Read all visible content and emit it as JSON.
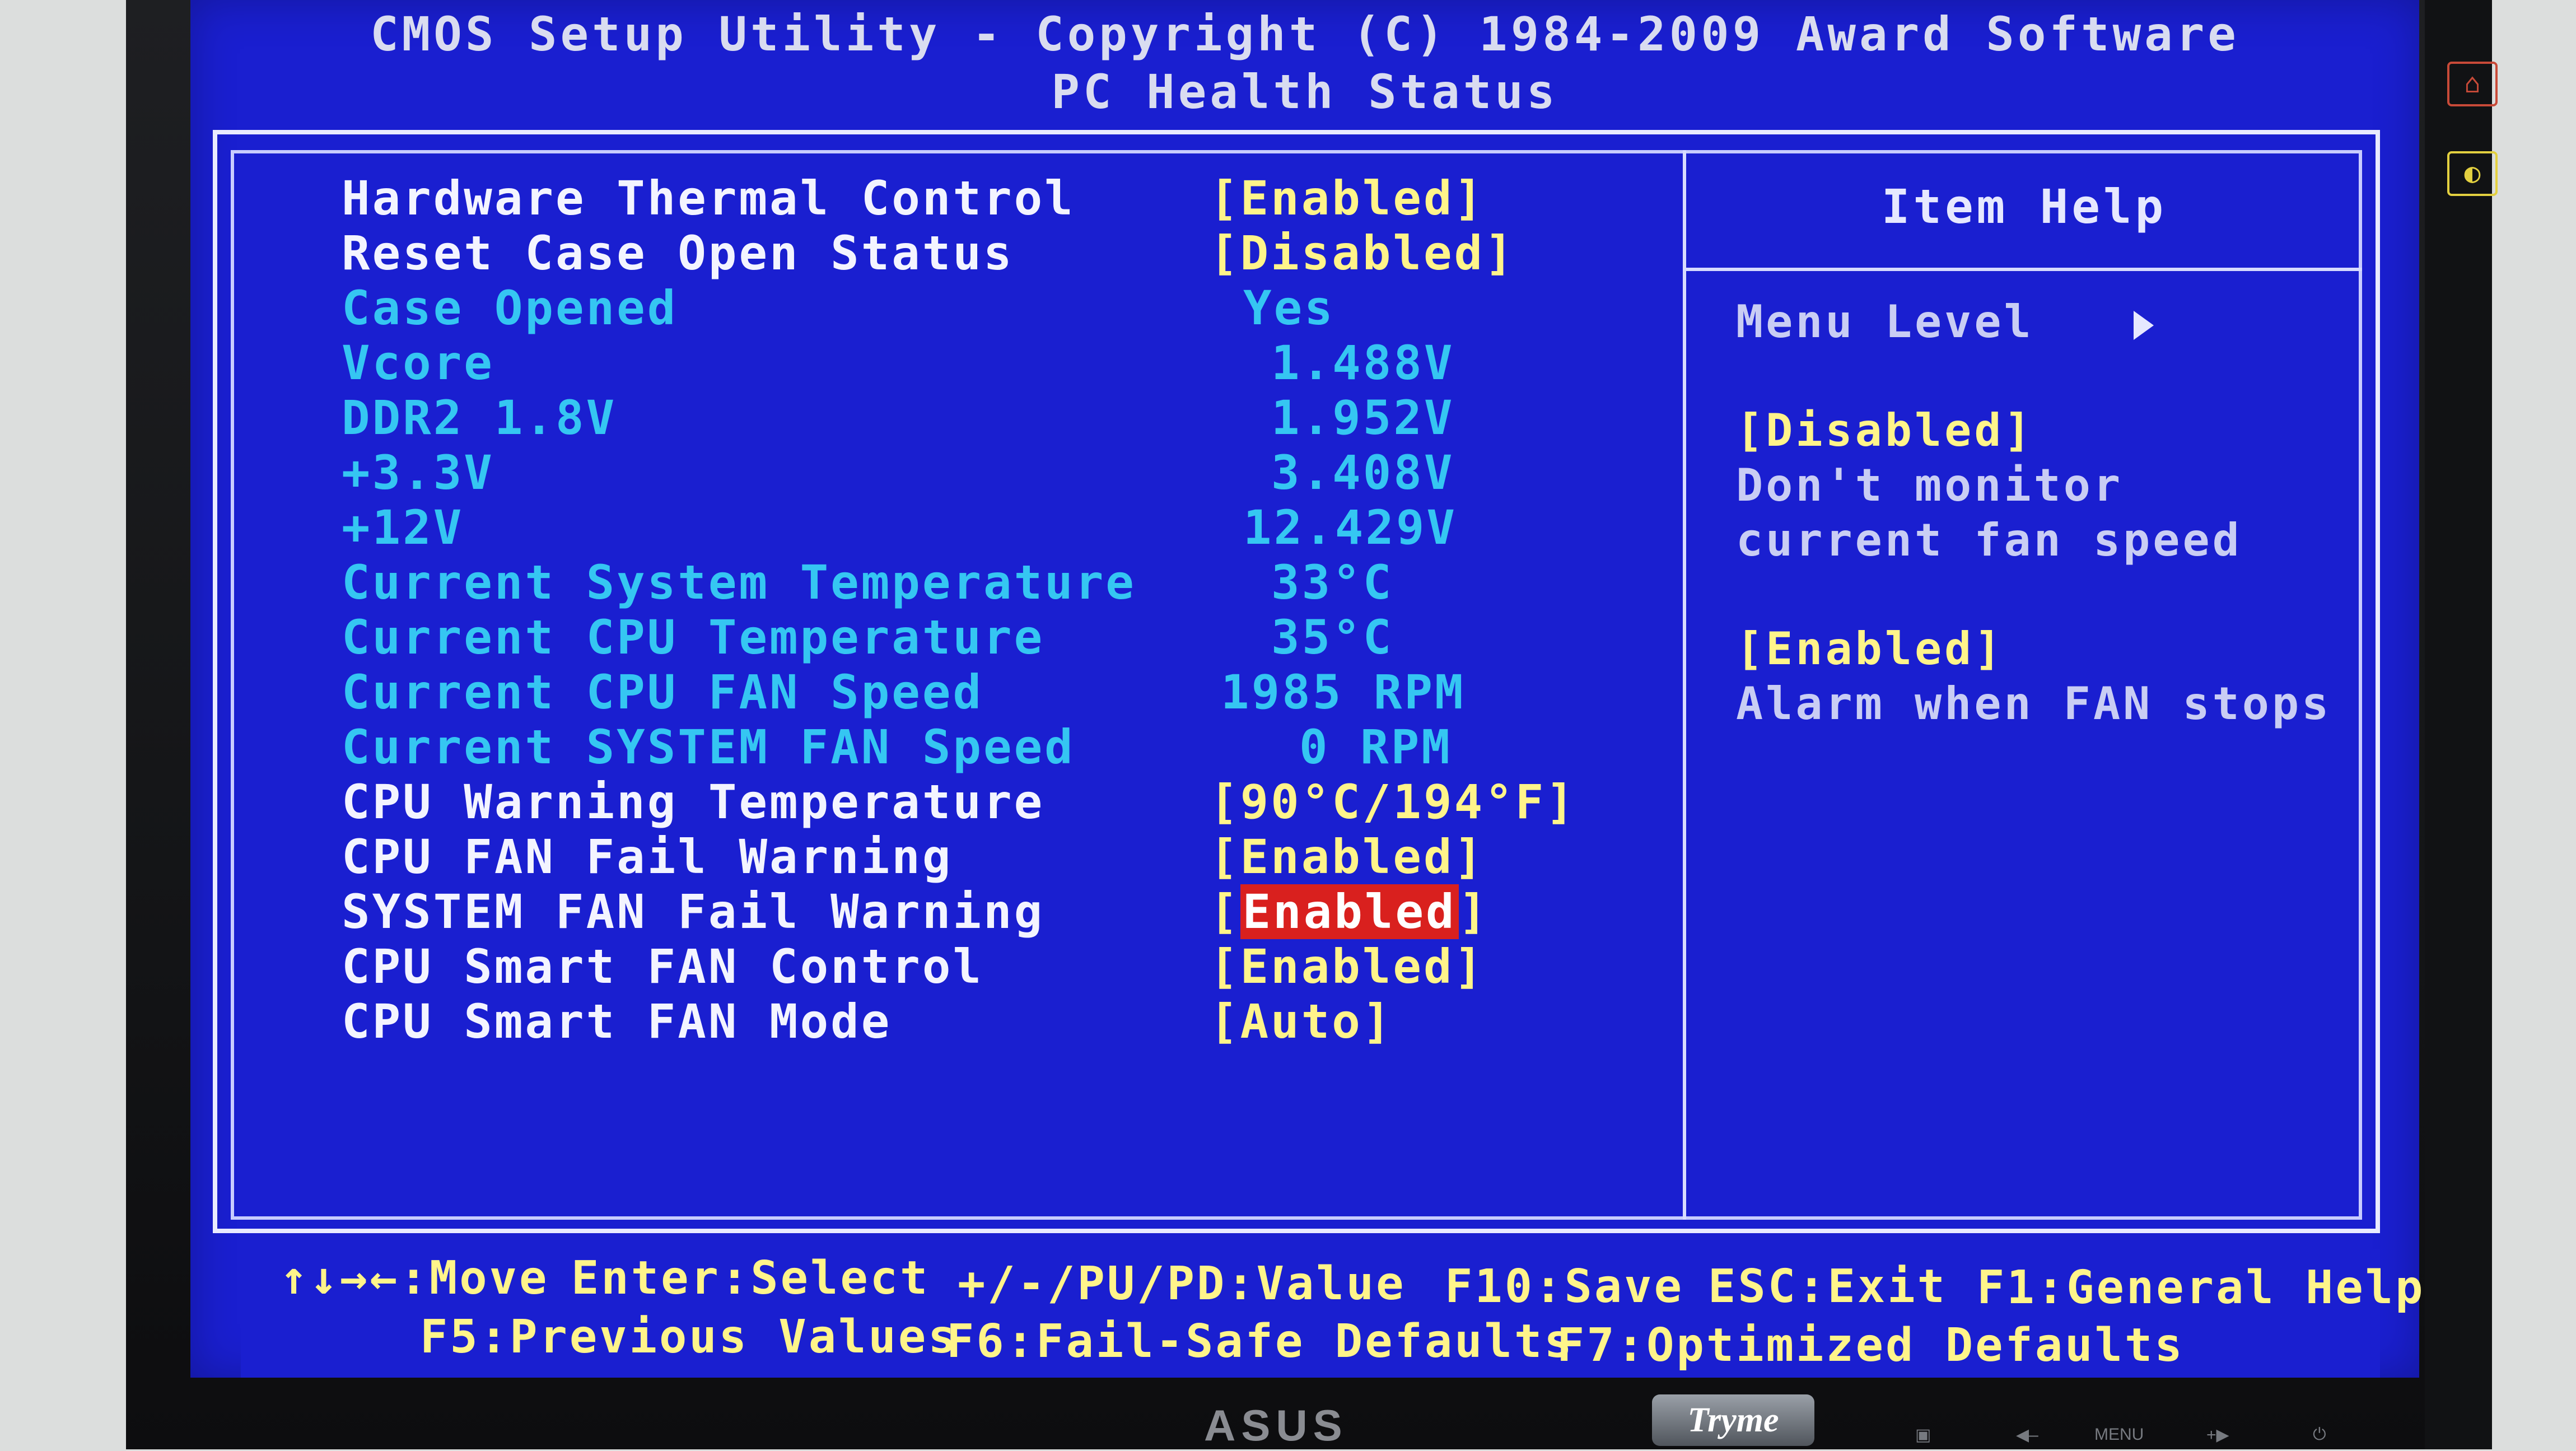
{
  "header": {
    "title": "CMOS Setup Utility - Copyright (C) 1984-2009 Award Software",
    "subtitle": "PC Health Status"
  },
  "settings": [
    {
      "label": "Hardware Thermal Control",
      "value": "[Enabled]",
      "type": "editable"
    },
    {
      "label": "Reset Case Open Status",
      "value": "[Disabled]",
      "type": "editable"
    },
    {
      "label": "Case Opened",
      "value": "Yes",
      "type": "readonly"
    },
    {
      "label": "Vcore",
      "value": "1.488V",
      "type": "readonly"
    },
    {
      "label": "DDR2 1.8V",
      "value": "1.952V",
      "type": "readonly"
    },
    {
      "label": "+3.3V",
      "value": "3.408V",
      "type": "readonly"
    },
    {
      "label": "+12V",
      "value": "12.429V",
      "type": "readonly"
    },
    {
      "label": "Current System Temperature",
      "value": "33°C",
      "type": "readonly"
    },
    {
      "label": "Current CPU Temperature",
      "value": "35°C",
      "type": "readonly"
    },
    {
      "label": "Current CPU FAN Speed",
      "value": "1985 RPM",
      "type": "readonly"
    },
    {
      "label": "Current SYSTEM FAN Speed",
      "value": "0 RPM",
      "type": "readonly"
    },
    {
      "label": "CPU Warning Temperature",
      "value": "[90°C/194°F]",
      "type": "editable"
    },
    {
      "label": "CPU FAN Fail Warning",
      "value": "[Enabled]",
      "type": "editable"
    },
    {
      "label": "SYSTEM FAN Fail Warning",
      "value": "Enabled",
      "type": "editable-selected"
    },
    {
      "label": "CPU Smart FAN Control",
      "value": "[Enabled]",
      "type": "editable"
    },
    {
      "label": "CPU Smart FAN Mode",
      "value": "[Auto]",
      "type": "editable"
    }
  ],
  "help": {
    "title": "Item Help",
    "menu_level": "Menu Level",
    "opt1_name": "[Disabled]",
    "opt1_line1": "Don't monitor",
    "opt1_line2": "current fan speed",
    "opt2_name": "[Enabled]",
    "opt2_line1": "Alarm when FAN stops"
  },
  "keys": {
    "move": "↑↓→←:Move",
    "select": "Enter:Select",
    "value": "+/-/PU/PD:Value",
    "save": "F10:Save",
    "exit": "ESC:Exit",
    "help": "F1:General Help",
    "previous": "F5:Previous Values",
    "failsafe": "F6:Fail-Safe Defaults",
    "optimized": "F7:Optimized Defaults"
  },
  "monitor": {
    "brand": "ASUS",
    "badge": "Tryme",
    "menu_label": "MENU"
  },
  "colors": {
    "screen_bg": "#1a1fd0",
    "editable_label": "#f3f4ff",
    "editable_value": "#fff48a",
    "readonly": "#35c6f2",
    "selection": "#d9201e"
  }
}
